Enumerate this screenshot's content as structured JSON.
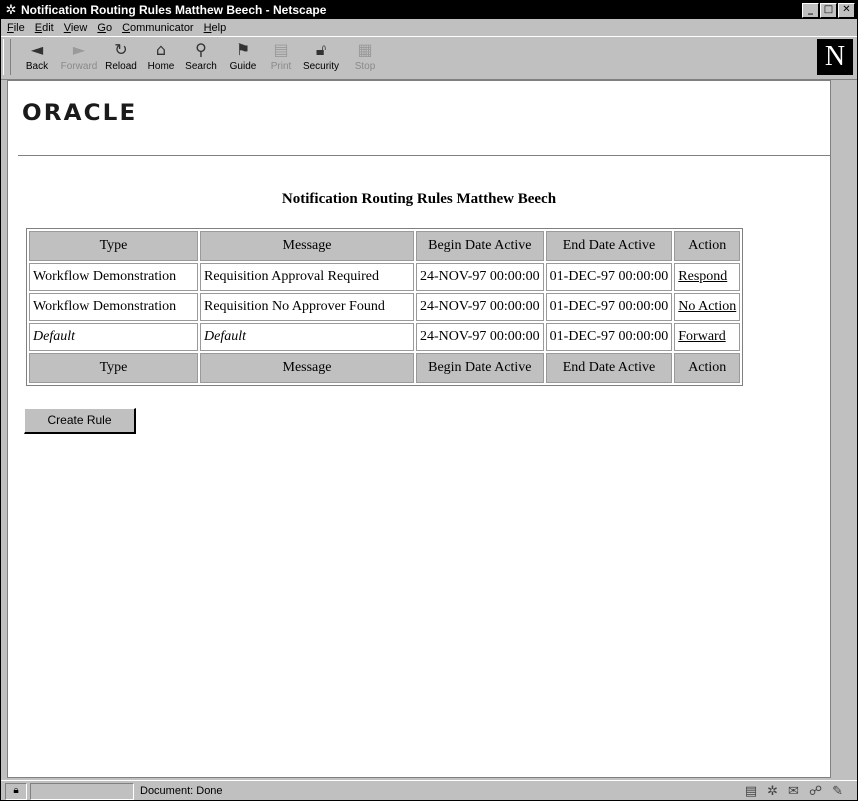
{
  "window": {
    "title": "Notification Routing Rules Matthew Beech - Netscape",
    "controls": [
      "_",
      "□",
      "✕"
    ]
  },
  "menu": [
    {
      "label": "File",
      "underline": "F"
    },
    {
      "label": "Edit",
      "underline": "E"
    },
    {
      "label": "View",
      "underline": "V"
    },
    {
      "label": "Go",
      "underline": "G"
    },
    {
      "label": "Communicator",
      "underline": "C"
    },
    {
      "label": "Help",
      "underline": "H"
    }
  ],
  "toolbar": {
    "back": "Back",
    "forward": "Forward",
    "reload": "Reload",
    "home": "Home",
    "search": "Search",
    "guide": "Guide",
    "print": "Print",
    "security": "Security",
    "stop": "Stop",
    "netscape_logo": "N"
  },
  "page": {
    "logo": "ORACLE",
    "title": "Notification Routing Rules Matthew Beech",
    "table": {
      "headers": [
        "Type",
        "Message",
        "Begin Date Active",
        "End Date Active",
        "Action"
      ],
      "rows": [
        {
          "type": "Workflow Demonstration",
          "message": "Requisition Approval Required",
          "begin": "24-NOV-97 00:00:00",
          "end": "01-DEC-97 00:00:00",
          "action": "Respond",
          "italic": false
        },
        {
          "type": "Workflow Demonstration",
          "message": "Requisition No Approver Found",
          "begin": "24-NOV-97 00:00:00",
          "end": "01-DEC-97 00:00:00",
          "action": "No Action",
          "italic": false
        },
        {
          "type": "Default",
          "message": "Default",
          "begin": "24-NOV-97 00:00:00",
          "end": "01-DEC-97 00:00:00",
          "action": "Forward",
          "italic": true
        }
      ]
    },
    "create_button": "Create Rule"
  },
  "status": {
    "text": "Document: Done"
  }
}
